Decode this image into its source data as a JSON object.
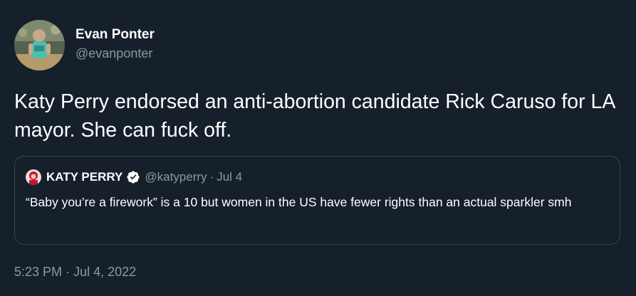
{
  "author": {
    "display_name": "Evan Ponter",
    "handle": "@evanponter"
  },
  "tweet": {
    "text": "Katy Perry endorsed an anti-abortion candidate Rick Caruso for LA mayor. She can fuck off."
  },
  "quoted_tweet": {
    "display_name": "KATY PERRY",
    "verified": true,
    "handle": "@katyperry",
    "separator": "·",
    "date": "Jul 4",
    "text": "“Baby you’re a firework” is a 10 but women in the US have fewer rights than an actual sparkler smh"
  },
  "timestamp": {
    "time": "5:23 PM",
    "separator": "·",
    "date": "Jul 4, 2022"
  },
  "colors": {
    "background": "#15202b",
    "text": "#ffffff",
    "secondary": "#8b98a5",
    "border": "#38444d",
    "verified_badge": "#ffffff"
  }
}
